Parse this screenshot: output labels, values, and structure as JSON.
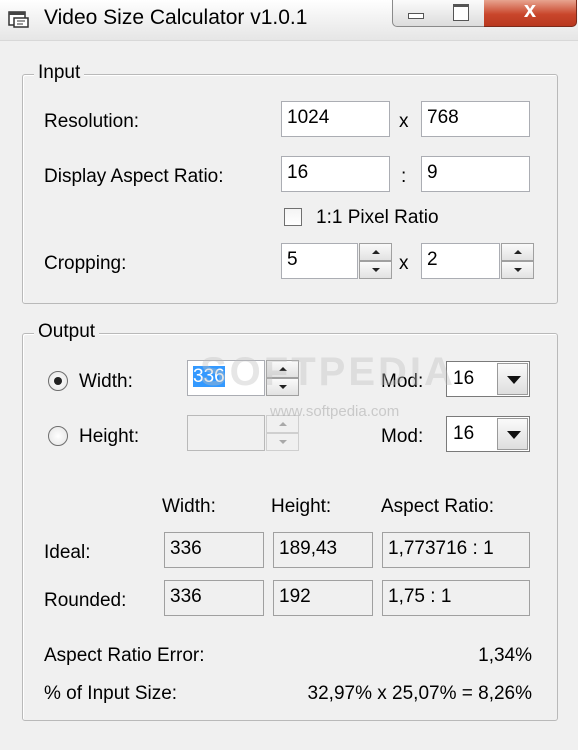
{
  "window": {
    "title": "Video Size Calculator v1.0.1",
    "icons": {
      "app": "video-window-icon",
      "minimize": "minimize-icon",
      "maximize": "maximize-icon",
      "close": "close-icon"
    },
    "close_glyph": "x",
    "close_color": "#c9462b"
  },
  "input": {
    "group_label": "Input",
    "resolution": {
      "label": "Resolution:",
      "width": "1024",
      "separator": "x",
      "height": "768"
    },
    "aspect": {
      "label": "Display Aspect Ratio:",
      "w": "16",
      "separator": ":",
      "h": "9"
    },
    "pixel_ratio": {
      "label": "1:1 Pixel Ratio",
      "checked": false
    },
    "cropping": {
      "label": "Cropping:",
      "a": "5",
      "separator": "x",
      "b": "2"
    }
  },
  "output": {
    "group_label": "Output",
    "width_option": {
      "label": "Width:",
      "selected": true,
      "value": "336",
      "mod_label": "Mod:",
      "mod_value": "16"
    },
    "height_option": {
      "label": "Height:",
      "selected": false,
      "value": "",
      "mod_label": "Mod:",
      "mod_value": "16"
    },
    "columns": {
      "width": "Width:",
      "height": "Height:",
      "aspect": "Aspect Ratio:"
    },
    "ideal": {
      "label": "Ideal:",
      "width": "336",
      "height": "189,43",
      "aspect": "1,773716 : 1"
    },
    "rounded": {
      "label": "Rounded:",
      "width": "336",
      "height": "192",
      "aspect": "1,75 : 1"
    },
    "aspect_error": {
      "label": "Aspect Ratio Error:",
      "value": "1,34%"
    },
    "input_size": {
      "label": "% of Input Size:",
      "value": "32,97% x 25,07% = 8,26%"
    }
  },
  "watermark": {
    "text": "SOFTPEDIA",
    "url": "www.softpedia.com"
  },
  "colors": {
    "selection": "#3399ff",
    "window_bg": "#f0f0f0"
  }
}
